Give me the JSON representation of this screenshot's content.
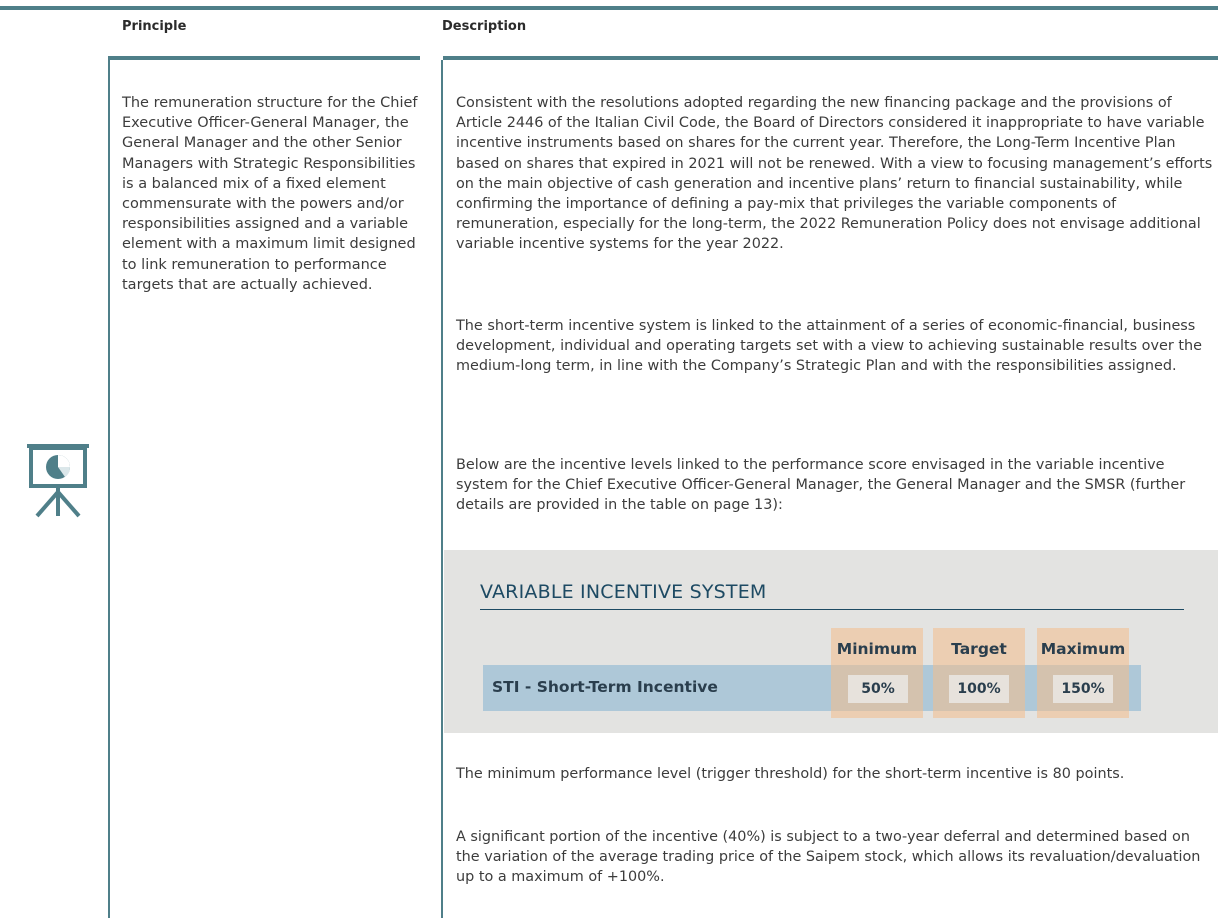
{
  "table": {
    "principle_header": "Principle",
    "description_header": "Description"
  },
  "principle_text": "The remuneration structure for the Chief Executive Officer-General Manager, the General Manager and the other Senior Managers with Strategic Responsibilities is a balanced mix of a fixed element commensurate with the powers and/or responsibilities assigned and a variable element with a maximum limit designed to link remuneration to performance targets that are actually achieved.",
  "description": {
    "para1": "Consistent with the resolutions adopted regarding the new financing package and the provisions of Article 2446 of the Italian Civil Code, the Board of Directors considered it inappropriate to have variable incentive instruments based on shares for the current year. Therefore, the Long-Term Incentive Plan based on shares that expired in 2021 will not be renewed. With a view to focusing management’s efforts on the main objective of cash generation and incentive plans’ return to financial sustainability, while confirming the importance of defining a pay-mix that privileges the variable components of remuneration, especially for the long-term, the 2022 Remuneration Policy does not envisage additional variable incentive systems for the year 2022.",
    "para2": "The short-term incentive system is linked to the attainment of a series of economic-financial, business development, individual and operating targets set with a view to achieving sustainable results over the medium-long term, in line with the Company’s Strategic Plan and with the responsibilities assigned.",
    "para3": "Below are the incentive levels linked to the performance score envisaged in the variable incentive system for the Chief Executive Officer-General Manager, the General Manager and the SMSR (further details are provided in the table on page 13):",
    "para4": "The minimum performance level (trigger threshold) for the short-term incentive is 80 points.",
    "para5": "A significant portion of the incentive (40%) is subject to a two-year deferral and determined based on the variation of the average trading price of the Saipem stock, which allows its revaluation/devaluation up to a maximum of +100%."
  },
  "incentive_box": {
    "title": "VARIABLE INCENTIVE SYSTEM",
    "columns": [
      "Minimum",
      "Target",
      "Maximum"
    ],
    "row_label": "STI - Short-Term Incentive",
    "values": [
      "50%",
      "100%",
      "150%"
    ]
  },
  "icon": "presentation-pie-chart-icon",
  "colors": {
    "rule": "#4f7f89",
    "title": "#1d4a63",
    "band": "#aec8d8",
    "highlight": "#f4be8c",
    "box_bg": "#e3e3e1"
  }
}
